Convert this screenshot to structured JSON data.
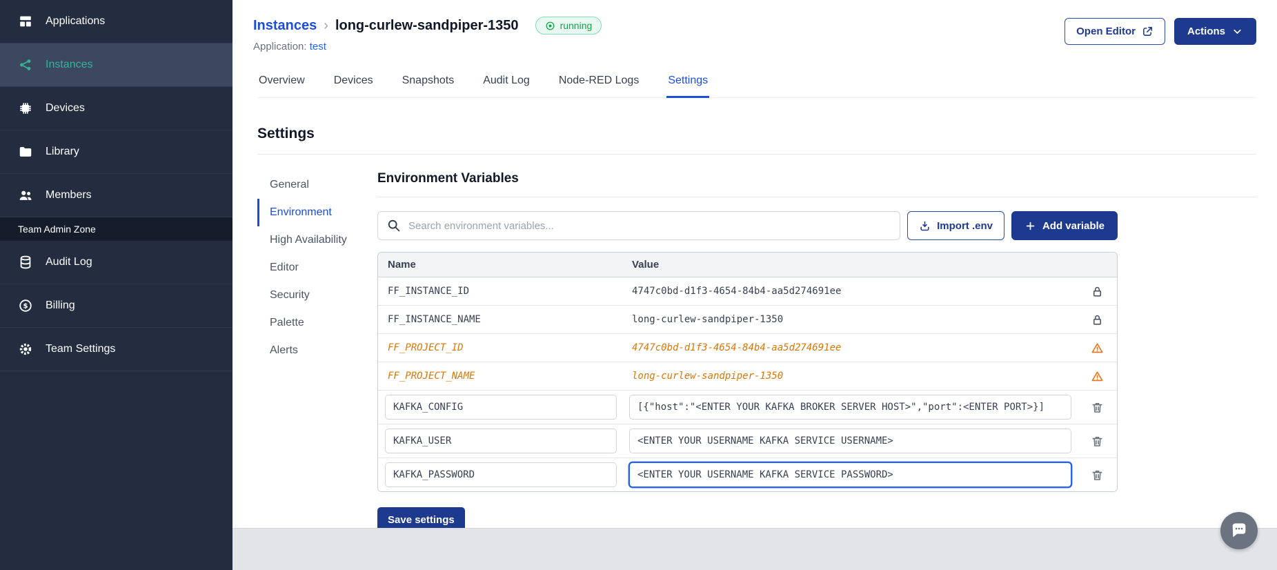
{
  "sidebar": {
    "items": [
      {
        "label": "Applications"
      },
      {
        "label": "Instances",
        "active": true
      },
      {
        "label": "Devices"
      },
      {
        "label": "Library"
      },
      {
        "label": "Members"
      }
    ],
    "section_label": "Team Admin Zone",
    "admin_items": [
      {
        "label": "Audit Log"
      },
      {
        "label": "Billing"
      },
      {
        "label": "Team Settings"
      }
    ]
  },
  "header": {
    "breadcrumb_root": "Instances",
    "breadcrumb_sep": "›",
    "instance_name": "long-curlew-sandpiper-1350",
    "status": "running",
    "application_label": "Application:",
    "application_name": "test",
    "open_editor": "Open Editor",
    "actions": "Actions"
  },
  "tabs": [
    "Overview",
    "Devices",
    "Snapshots",
    "Audit Log",
    "Node-RED Logs",
    "Settings"
  ],
  "active_tab": "Settings",
  "settings": {
    "title": "Settings",
    "nav": [
      "General",
      "Environment",
      "High Availability",
      "Editor",
      "Security",
      "Palette",
      "Alerts"
    ],
    "active_nav": "Environment"
  },
  "env": {
    "title": "Environment Variables",
    "search_placeholder": "Search environment variables...",
    "import_env": "Import .env",
    "add_variable": "Add variable",
    "save": "Save settings",
    "table": {
      "name_header": "Name",
      "value_header": "Value",
      "rows": [
        {
          "name": "FF_INSTANCE_ID",
          "value": "4747c0bd-d1f3-4654-84b4-aa5d274691ee",
          "type": "locked"
        },
        {
          "name": "FF_INSTANCE_NAME",
          "value": "long-curlew-sandpiper-1350",
          "type": "locked"
        },
        {
          "name": "FF_PROJECT_ID",
          "value": "4747c0bd-d1f3-4654-84b4-aa5d274691ee",
          "type": "deprecated"
        },
        {
          "name": "FF_PROJECT_NAME",
          "value": "long-curlew-sandpiper-1350",
          "type": "deprecated"
        },
        {
          "name": "KAFKA_CONFIG",
          "value": "[{\"host\":\"<ENTER YOUR KAFKA BROKER SERVER HOST>\",\"port\":<ENTER PORT>}]",
          "type": "editable"
        },
        {
          "name": "KAFKA_USER",
          "value": "<ENTER YOUR USERNAME KAFKA SERVICE USERNAME>",
          "type": "editable"
        },
        {
          "name": "KAFKA_PASSWORD",
          "value": "<ENTER YOUR USERNAME KAFKA SERVICE PASSWORD>",
          "type": "editable",
          "focused": true
        }
      ]
    }
  },
  "colors": {
    "sidebar_bg": "#232d3f",
    "active_teal": "#35b397",
    "link_blue": "#1d4ed8",
    "button_navy": "#1e3a8f",
    "status_green": "#17a34a",
    "warning_orange": "#d97706"
  }
}
